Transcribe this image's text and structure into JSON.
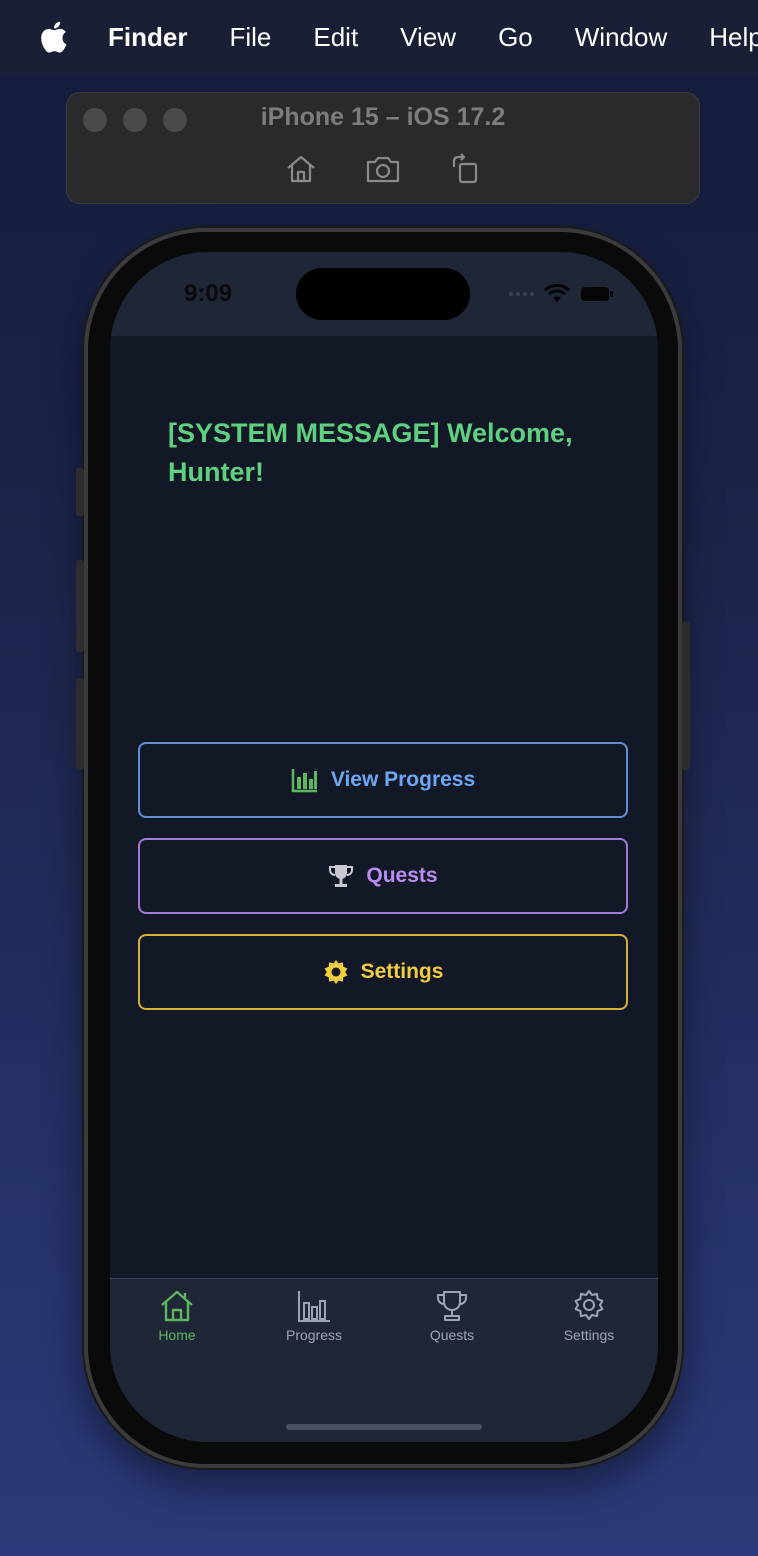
{
  "menubar": {
    "apple_icon": "apple-logo-icon",
    "items": [
      "Finder",
      "File",
      "Edit",
      "View",
      "Go",
      "Window",
      "Help"
    ]
  },
  "simulator": {
    "title": "iPhone 15 – iOS 17.2",
    "tools": [
      "home-icon",
      "screenshot-icon",
      "rotate-icon"
    ]
  },
  "status_bar": {
    "time": "9:09"
  },
  "app": {
    "welcome": "[SYSTEM MESSAGE] Welcome, Hunter!",
    "buttons": {
      "progress": "View Progress",
      "quests": "Quests",
      "settings": "Settings"
    },
    "colors": {
      "welcome": "#5fd07f",
      "progress": "#6ea6f2",
      "quests": "#b98cf4",
      "settings": "#f2cd3e",
      "active_tab": "#5fb560"
    }
  },
  "tabbar": {
    "tabs": [
      {
        "label": "Home",
        "icon": "home-icon",
        "active": true
      },
      {
        "label": "Progress",
        "icon": "bar-chart-icon",
        "active": false
      },
      {
        "label": "Quests",
        "icon": "trophy-icon",
        "active": false
      },
      {
        "label": "Settings",
        "icon": "gear-icon",
        "active": false
      }
    ]
  }
}
